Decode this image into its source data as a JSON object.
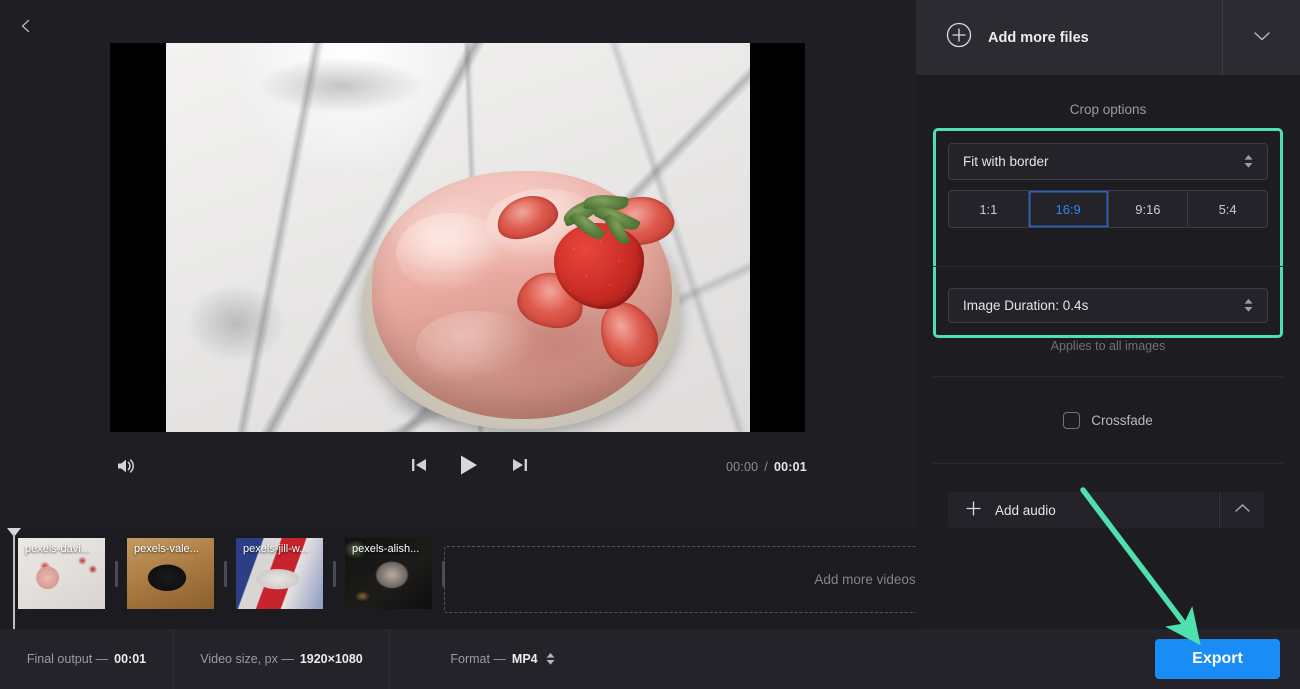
{
  "app": {
    "back_icon": "chevron-left-icon"
  },
  "preview": {
    "volume_icon": "speaker-icon",
    "prev_icon": "skip-previous-icon",
    "play_icon": "play-icon",
    "next_icon": "skip-next-icon",
    "current_time": "00:00",
    "separator": "/",
    "total_time": "00:01"
  },
  "timeline": {
    "clips": [
      {
        "label": "pexels-davi...",
        "art": "th1"
      },
      {
        "label": "pexels-vale...",
        "art": "th2"
      },
      {
        "label": "pexels-jill-w...",
        "art": "th3"
      },
      {
        "label": "pexels-alish...",
        "art": "th4"
      }
    ],
    "dropzone_label": "Add more videos"
  },
  "bottombar": {
    "final_output_label": "Final output —",
    "final_output_value": "00:01",
    "video_size_label": "Video size, px —",
    "video_size_value": "1920×1080",
    "format_label": "Format —",
    "format_value": "MP4",
    "export_label": "Export"
  },
  "sidepanel": {
    "add_files_label": "Add more files",
    "add_files_icon": "plus-circle-icon",
    "collapse_icon": "chevron-down-icon",
    "crop_title": "Crop options",
    "crop_mode_value": "Fit with border",
    "ratios": [
      {
        "label": "1:1",
        "active": false
      },
      {
        "label": "16:9",
        "active": true
      },
      {
        "label": "9:16",
        "active": false
      },
      {
        "label": "5:4",
        "active": false
      }
    ],
    "duration_value": "Image Duration: 0.4s",
    "applies_note": "Applies to all images",
    "crossfade_label": "Crossfade",
    "crossfade_checked": false,
    "add_audio_label": "Add audio",
    "add_audio_icon": "plus-icon",
    "audio_toggle_icon": "chevron-up-icon"
  },
  "colors": {
    "accent_blue": "#1a8cf5",
    "selected_blue": "#2e86f0",
    "annotation_teal": "#4fe0ad",
    "panel_bg": "#1c1c21",
    "header_bg": "#2b2b31",
    "bottombar_bg": "#232329"
  }
}
